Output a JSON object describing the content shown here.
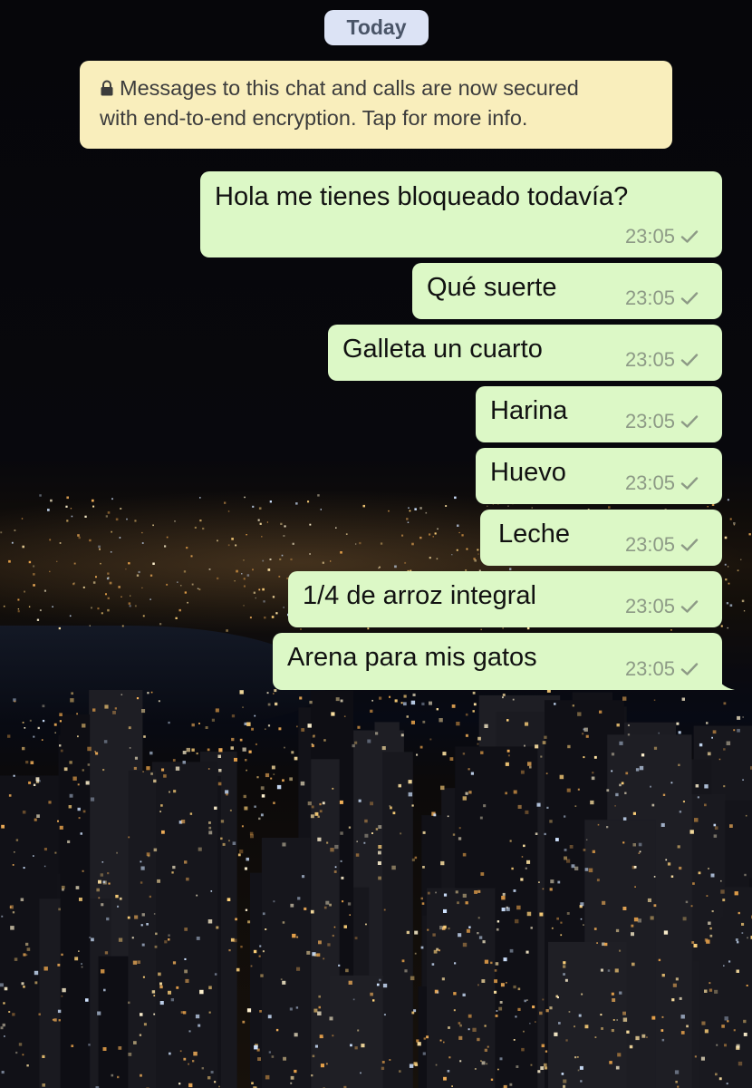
{
  "chat": {
    "date_label": "Today",
    "encryption_notice": {
      "line1": "Messages to this chat and calls are now secured",
      "line2": "with end-to-end encryption. Tap for more info.",
      "icon": "lock-icon"
    },
    "messages": [
      {
        "text": "Hola me tienes bloqueado todavía?",
        "time": "23:05",
        "status_icon": "single-check-icon"
      },
      {
        "text": "Qué suerte",
        "time": "23:05",
        "status_icon": "single-check-icon"
      },
      {
        "text": "Galleta un cuarto",
        "time": "23:05",
        "status_icon": "single-check-icon"
      },
      {
        "text": "Harina",
        "time": "23:05",
        "status_icon": "single-check-icon"
      },
      {
        "text": "Huevo",
        "time": "23:05",
        "status_icon": "single-check-icon"
      },
      {
        "text": "Leche",
        "time": "23:05",
        "status_icon": "single-check-icon"
      },
      {
        "text": "1/4 de arroz integral",
        "time": "23:05",
        "status_icon": "single-check-icon"
      },
      {
        "text": "Arena para mis gatos",
        "time": "23:05",
        "status_icon": "single-check-icon"
      }
    ]
  },
  "colors": {
    "outgoing_bubble": "#dcf8c6",
    "date_pill": "#dce3f5",
    "encryption_notice": "#f9eebc",
    "timestamp": "#8d9a86"
  }
}
